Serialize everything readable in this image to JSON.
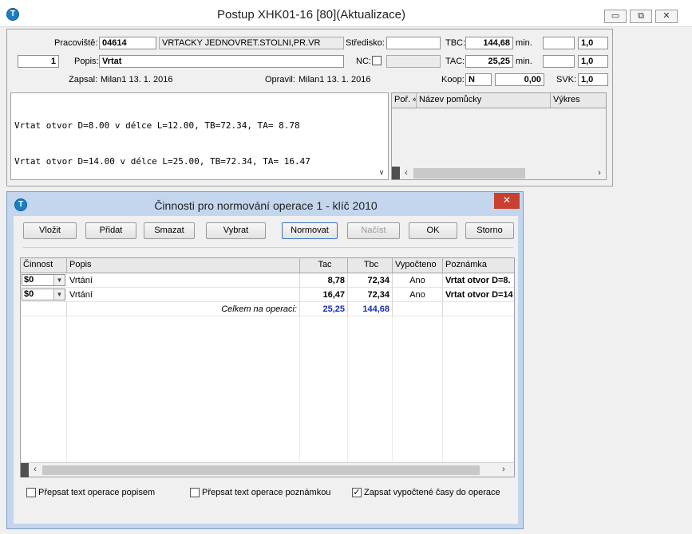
{
  "main_window": {
    "title": "Postup XHK01-16  [80](Aktualizace)",
    "icon": "t-logo-icon",
    "controls": {
      "minimize": "▭",
      "restore": "⧉",
      "close": "✕"
    }
  },
  "form": {
    "pracoviste_label": "Pracoviště:",
    "pracoviste_code": "04614",
    "pracoviste_name": "VRTACKY JEDNOVRET.STOLNI,PR.VR",
    "stredisko_label": "Středisko:",
    "stredisko_value": "",
    "tbc_label": "TBC:",
    "tbc_value": "144,68",
    "tbc_unit": "min.",
    "tbc_extra": "",
    "tbc_coef": "1,0",
    "row_number": "1",
    "popis_label": "Popis:",
    "popis_value": "Vrtat",
    "nc_label": "NC:",
    "nc_value": "",
    "tac_label": "TAC:",
    "tac_value": "25,25",
    "tac_unit": "min.",
    "tac_extra": "",
    "tac_coef": "1,0",
    "zapsal_label": "Zapsal:",
    "zapsal_value": "Milan1  13. 1. 2016",
    "opravil_label": "Opravil:",
    "opravil_value": "Milan1  13. 1. 2016",
    "koop_label": "Koop:",
    "koop_flag": "N",
    "koop_value": "0,00",
    "svk_label": "SVK:",
    "svk_value": "1,0"
  },
  "operation_text": [
    "Vrtat otvor D=8.00 v délce L=12.00, TB=72.34, TA= 8.78",
    "Vrtat otvor D=14.00 v délce L=25.00, TB=72.34, TA= 16.47"
  ],
  "tools_grid": {
    "columns": [
      "Poř. «",
      "Název pomůcky",
      "Výkres"
    ]
  },
  "dialog": {
    "title": "Činnosti pro normování operace 1 - klíč 2010",
    "close": "✕",
    "buttons": {
      "vlozit": "Vložit",
      "pridat": "Přidat",
      "smazat": "Smazat",
      "vybrat": "Vybrat",
      "normovat": "Normovat",
      "nacist": "Načíst",
      "ok": "OK",
      "storno": "Storno"
    },
    "columns": [
      "Činnost",
      "Popis",
      "Tac",
      "Tbc",
      "Vypočteno",
      "Poznámka"
    ],
    "rows": [
      {
        "cinnost": "$0",
        "popis": "Vrtání",
        "tac": "8,78",
        "tbc": "72,34",
        "vypocteno": "Ano",
        "poznamka": "Vrtat otvor D=8."
      },
      {
        "cinnost": "$0",
        "popis": "Vrtání",
        "tac": "16,47",
        "tbc": "72,34",
        "vypocteno": "Ano",
        "poznamka": "Vrtat otvor D=14"
      }
    ],
    "total_label": "Celkem na operaci:",
    "total_tac": "25,25",
    "total_tbc": "144,68",
    "options": [
      {
        "label": "Přepsat text operace popisem",
        "checked": false
      },
      {
        "label": "Přepsat text operace poznámkou",
        "checked": false
      },
      {
        "label": "Zapsat vypočtené časy do operace",
        "checked": true
      }
    ]
  },
  "colors": {
    "dialog_frame": "#c3d6ed",
    "close_button": "#c84031",
    "total_values": "#1a2fb0"
  }
}
